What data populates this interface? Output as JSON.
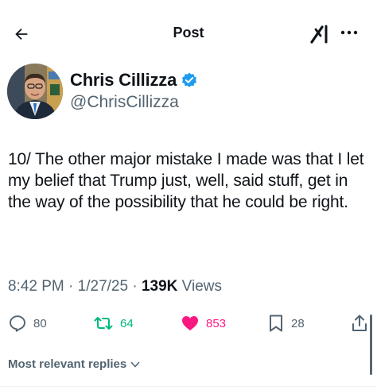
{
  "header": {
    "title": "Post",
    "back_icon": "back-arrow-icon",
    "grok_icon": "grok-icon",
    "more_icon": "more-horizontal-icon"
  },
  "author": {
    "display_name": "Chris Cillizza",
    "handle": "@ChrisCillizza",
    "verified": true,
    "verified_color": "#1d9bf0"
  },
  "post": {
    "text": "10/ The other major mistake I made was that I let my belief that Trump just, well, said stuff, get in the way of the possibility that he could be right.",
    "time": "8:42 PM",
    "separator": "·",
    "date": "1/27/25",
    "views_count": "139K",
    "views_label": "Views"
  },
  "actions": {
    "replies": "80",
    "reposts": "64",
    "likes": "853",
    "bookmarks": "28",
    "repost_color": "#00ba7c",
    "like_color": "#f91880"
  },
  "replies_sort": {
    "label": "Most relevant replies"
  }
}
